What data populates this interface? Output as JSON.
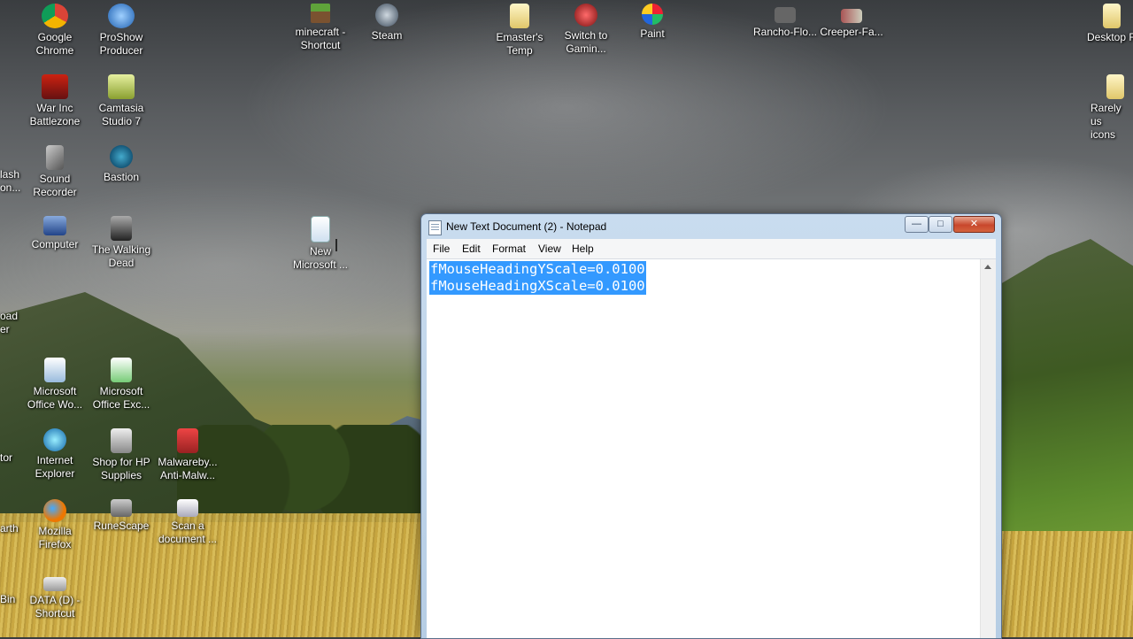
{
  "desktop_icons": {
    "google_chrome": "Google\nChrome",
    "proshow_producer": "ProShow\nProducer",
    "minecraft_shortcut": "minecraft -\nShortcut",
    "steam": "Steam",
    "emasters_temp": "Emaster's\nTemp",
    "switch_to_gaming": "Switch to\nGamin...",
    "paint": "Paint",
    "rancho_flo": "Rancho-Flo...",
    "creeper_fa": "Creeper-Fa...",
    "desktop_f": "Desktop F",
    "war_inc": "War Inc\nBattlezone",
    "camtasia": "Camtasia\nStudio 7",
    "rarely_used": "Rarely us\nicons",
    "sound_recorder": "Sound\nRecorder",
    "bastion": "Bastion",
    "computer": "Computer",
    "walking_dead": "The Walking\nDead",
    "new_microsoft": "New\nMicrosoft ...",
    "ms_word": "Microsoft\nOffice Wo...",
    "ms_excel": "Microsoft\nOffice Exc...",
    "internet_explorer": "Internet\nExplorer",
    "hp_supplies": "Shop for HP\nSupplies",
    "malwarebytes": "Malwareby...\nAnti-Malw...",
    "firefox": "Mozilla\nFirefox",
    "runescape": "RuneScape",
    "scan_document": "Scan a\ndocument ...",
    "data_d": "DATA (D) -\nShortcut",
    "clip_flash": "lash\non...",
    "clip_load": "oad\ner",
    "clip_tor": "tor",
    "clip_earth": "arth",
    "clip_bin": "Bin"
  },
  "notepad": {
    "title": "New Text Document (2) - Notepad",
    "menu": [
      "File",
      "Edit",
      "Format",
      "View",
      "Help"
    ],
    "lines": [
      "fMouseHeadingYScale=0.0100",
      "fMouseHeadingXScale=0.0100"
    ],
    "selection_color": "#3399ff"
  }
}
